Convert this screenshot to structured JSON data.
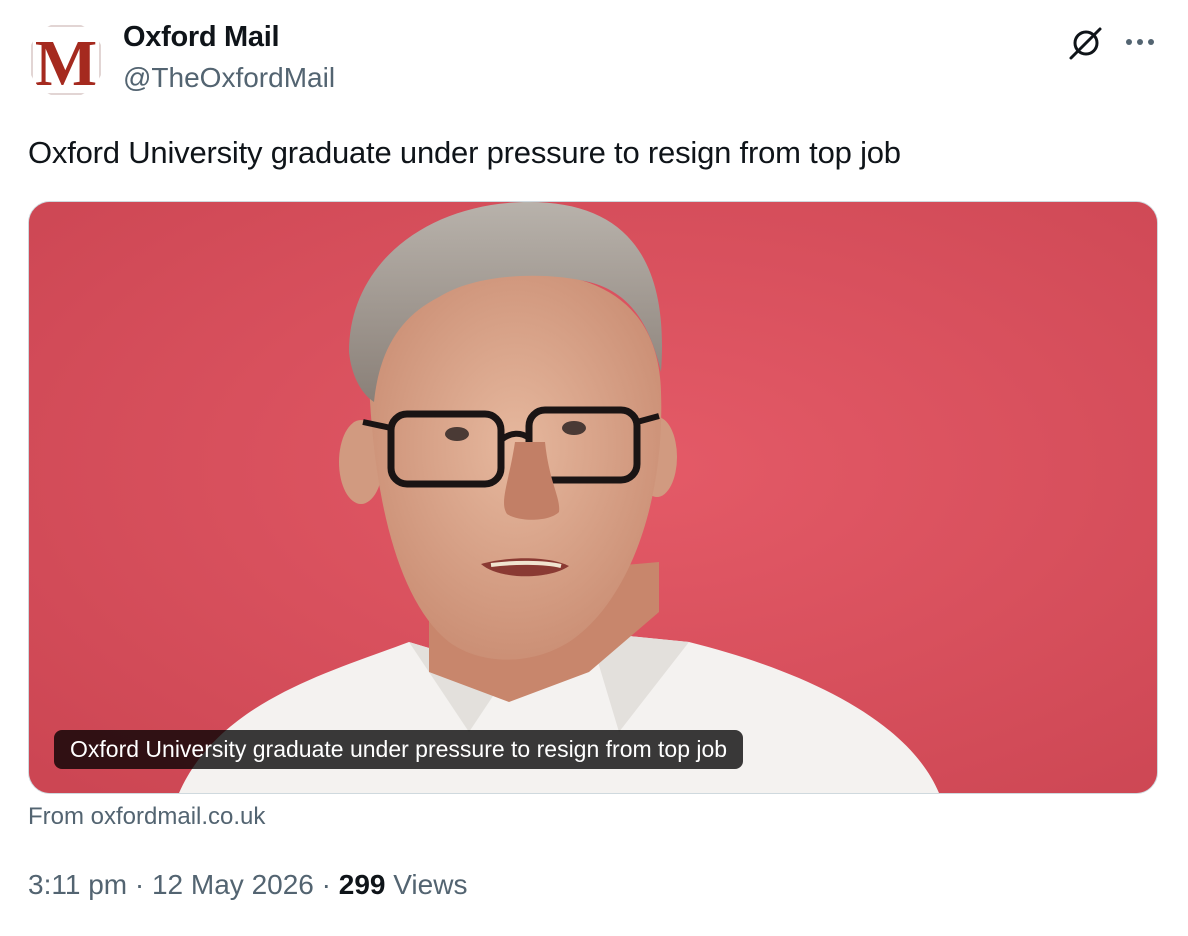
{
  "author": {
    "display_name": "Oxford Mail",
    "handle": "@TheOxfordMail",
    "avatar_letter": "M",
    "avatar_color": "#a52a1f"
  },
  "actions": {
    "grok_icon": "grok-icon",
    "more_icon": "more-icon"
  },
  "tweet": {
    "text": "Oxford University graduate under pressure to resign from top job"
  },
  "card": {
    "title": "Oxford University graduate under pressure to resign from top job",
    "source": "From oxfordmail.co.uk",
    "background_color": "#d9505d"
  },
  "meta": {
    "time": "3:11 pm",
    "separator1": "·",
    "date": "12 May 2026",
    "separator2": "·",
    "views_count": "299",
    "views_label": "Views"
  }
}
